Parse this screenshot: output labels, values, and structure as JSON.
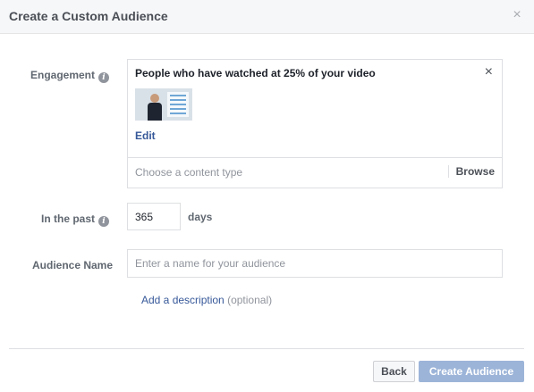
{
  "dialog": {
    "title": "Create a Custom Audience",
    "close_icon": "×"
  },
  "engagement": {
    "label": "Engagement",
    "info_icon": "i",
    "selected_title": "People who have watched at 25% of your video",
    "remove_icon": "×",
    "thumbnail": "video-thumbnail",
    "edit_label": "Edit",
    "content_type_placeholder": "Choose a content type",
    "browse_label": "Browse"
  },
  "past": {
    "label": "In the past",
    "info_icon": "i",
    "days_value": "365",
    "days_unit": "days"
  },
  "audience_name": {
    "label": "Audience Name",
    "placeholder": "Enter a name for your audience",
    "value": ""
  },
  "description": {
    "link_label": "Add a description",
    "optional_label": "(optional)"
  },
  "footer": {
    "back_label": "Back",
    "create_label": "Create Audience"
  },
  "colors": {
    "link": "#365899",
    "create_button_disabled": "#9cb4d8",
    "header_bg": "#f6f7f9"
  }
}
